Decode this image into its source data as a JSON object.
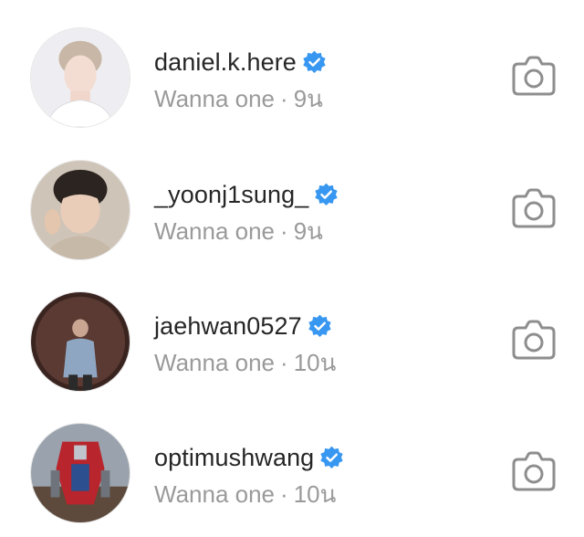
{
  "accounts": [
    {
      "username": "daniel.k.here",
      "subtitle": "Wanna one",
      "separator": "·",
      "time": "9น",
      "verified_icon": "verified-badge-icon",
      "action_icon": "camera-icon"
    },
    {
      "username": "_yoonj1sung_",
      "subtitle": "Wanna one",
      "separator": "·",
      "time": "9น",
      "verified_icon": "verified-badge-icon",
      "action_icon": "camera-icon"
    },
    {
      "username": "jaehwan0527",
      "subtitle": "Wanna one",
      "separator": "·",
      "time": "10น",
      "verified_icon": "verified-badge-icon",
      "action_icon": "camera-icon"
    },
    {
      "username": "optimushwang",
      "subtitle": "Wanna one",
      "separator": "·",
      "time": "10น",
      "verified_icon": "verified-badge-icon",
      "action_icon": "camera-icon"
    }
  ],
  "colors": {
    "username": "#262626",
    "subtitle": "#9a9a9a",
    "verified_blue": "#3897f0",
    "icon_gray": "#8e8e8e"
  }
}
